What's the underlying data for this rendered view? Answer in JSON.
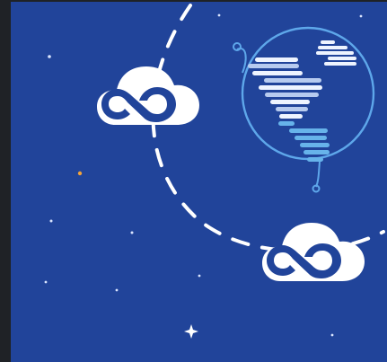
{
  "scene": {
    "colors": {
      "outer_frame": "#1f2226",
      "background": "#21449a",
      "orbit": "#ffffff",
      "cloud": "#ffffff",
      "globe_outline": "#5ea7ea",
      "continent_light": "#eef4ff",
      "continent_mid": "#b7cbef",
      "continent_blue": "#67b3ea",
      "accent_star": "#f2a33a"
    },
    "icons": [
      "cloud-link-icon",
      "globe-icon",
      "star-icon"
    ]
  }
}
